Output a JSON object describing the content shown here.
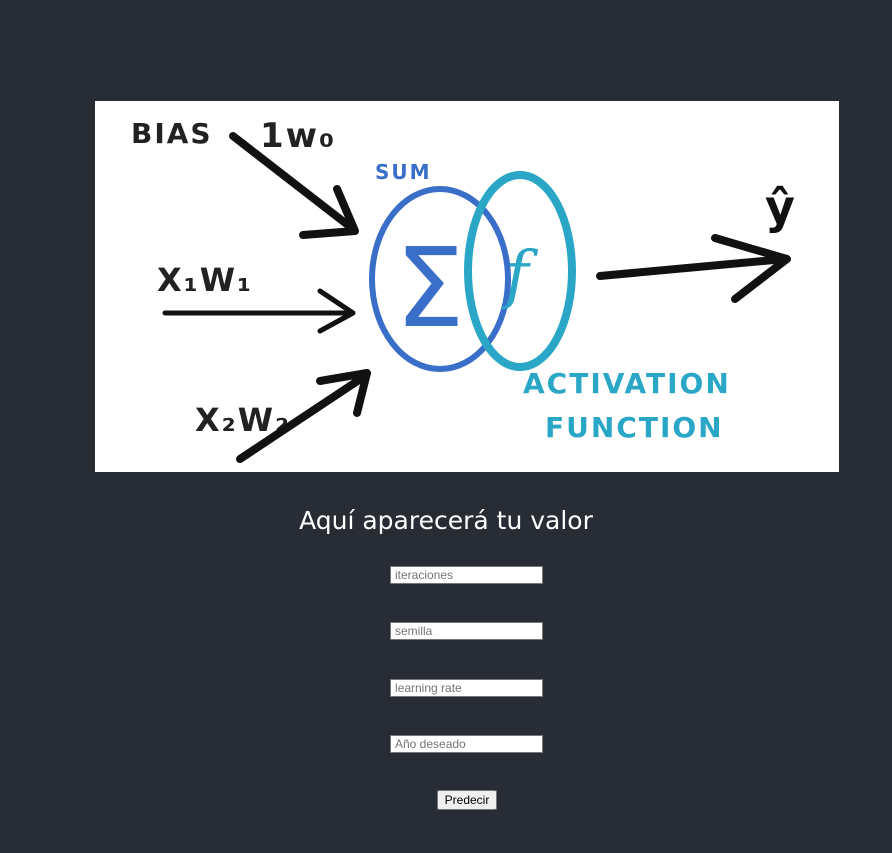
{
  "image": {
    "labels": {
      "bias": "BIAS",
      "w0": "1w₀",
      "x1w1": "X₁W₁",
      "x2w2": "X₂W₂",
      "sum": "SUM",
      "sigma": "Σ",
      "f": "f",
      "yhat": "ŷ",
      "activation_line1": "ACTIVATION",
      "activation_line2": "FUNCTION"
    }
  },
  "result": {
    "text": "Aquí aparecerá tu valor"
  },
  "form": {
    "iteraciones_placeholder": "iteraciones",
    "semilla_placeholder": "semilla",
    "learning_rate_placeholder": "learning rate",
    "anio_placeholder": "Año deseado",
    "submit_label": "Predecir"
  },
  "colors": {
    "background": "#282c34",
    "sum_blue": "#3a6fc9",
    "activation_teal": "#2aa6c7",
    "ink": "#111111"
  }
}
